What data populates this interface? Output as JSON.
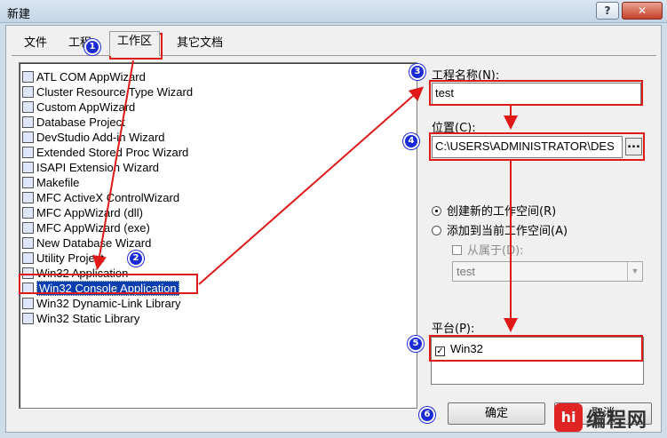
{
  "window": {
    "title": "新建",
    "help": "?",
    "close": "✕"
  },
  "tabs": [
    "文件",
    "工程",
    "工作区",
    "其它文档"
  ],
  "projects": [
    "ATL COM AppWizard",
    "Cluster Resource Type Wizard",
    "Custom AppWizard",
    "Database Project",
    "DevStudio Add-in Wizard",
    "Extended Stored Proc Wizard",
    "ISAPI Extension Wizard",
    "Makefile",
    "MFC ActiveX ControlWizard",
    "MFC AppWizard (dll)",
    "MFC AppWizard (exe)",
    "New Database Wizard",
    "Utility Project",
    "Win32 Application",
    "Win32 Console Application",
    "Win32 Dynamic-Link Library",
    "Win32 Static Library"
  ],
  "selected_project": "Win32 Console Application",
  "project_name": {
    "label": "工程名称(N):",
    "value": "test"
  },
  "location": {
    "label": "位置(C):",
    "value": "C:\\USERS\\ADMINISTRATOR\\DES",
    "browse": "..."
  },
  "workspace": {
    "create_new": "创建新的工作空间(R)",
    "add_current": "添加到当前工作空间(A)",
    "depend_on": "从属于(D):",
    "depend_value": "test"
  },
  "platform": {
    "label": "平台(P):",
    "item": "Win32",
    "checked": true
  },
  "buttons": {
    "ok": "确定",
    "cancel": "取消"
  },
  "badges": [
    "1",
    "2",
    "3",
    "4",
    "5",
    "6"
  ],
  "watermark": {
    "logo": "hi",
    "text": "编程网"
  },
  "colors": {
    "highlight": "#e01818",
    "badge": "#1a2bd8",
    "selection": "#0a3fb0"
  }
}
